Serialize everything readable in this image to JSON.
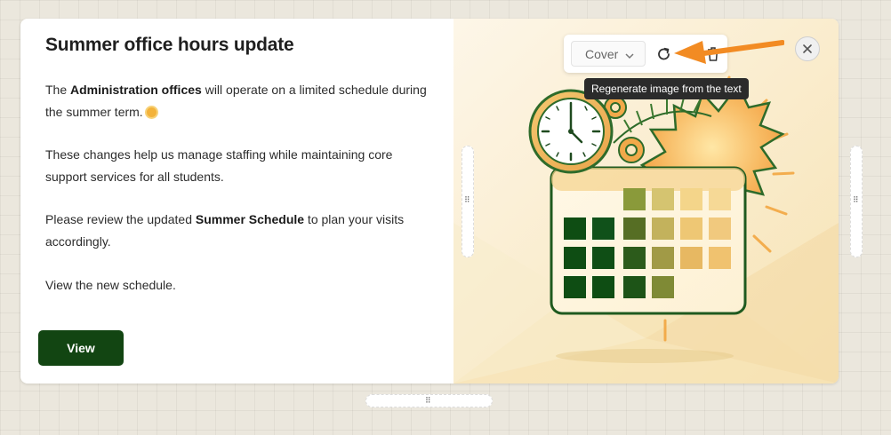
{
  "card": {
    "title": "Summer office hours update",
    "paragraphs": {
      "p1_pre": "The ",
      "p1_bold": "Administration offices",
      "p1_post": " will operate on a limited schedule during the summer term.",
      "p2": "These changes help us manage staffing while maintaining core support services for all students.",
      "p3_pre": "Please review the updated ",
      "p3_bold": "Summer Schedule",
      "p3_post": " to plan your visits accordingly.",
      "p4": "View the new schedule."
    },
    "button_label": "View"
  },
  "image_toolbar": {
    "fit_select_value": "Cover",
    "regenerate_tooltip": "Regenerate image from the text",
    "icons": [
      "chevron-down-icon",
      "refresh-icon",
      "trash-icon",
      "close-icon"
    ]
  },
  "colors": {
    "accent_green": "#124512",
    "annotation_arrow": "#f28b23",
    "tooltip_bg": "#2b2b2b"
  }
}
